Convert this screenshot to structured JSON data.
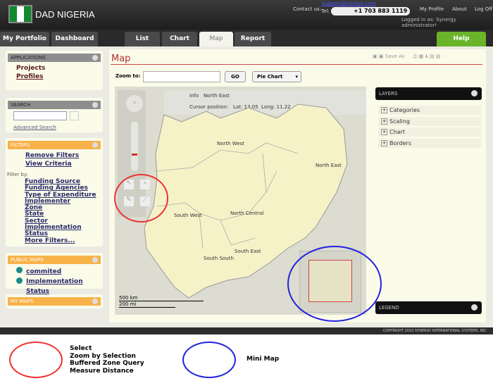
{
  "header": {
    "app_title": "DAD NIGERIA",
    "contact_label": "Contact us:",
    "email": "support@synisys.com",
    "tel_label": "Tel:",
    "phone": "+1 703 883 1119",
    "links": [
      "My Profile",
      "About",
      "Log Off"
    ],
    "logged_in": "Logged in as: Synergy administrator!"
  },
  "nav": {
    "portfolio": "My Portfolio",
    "dashboard": "Dashboard",
    "tabs": [
      "List",
      "Chart",
      "Map",
      "Report"
    ],
    "active_tab": "Map",
    "help": "Help"
  },
  "sidebar": {
    "applications": {
      "title": "APPLICATIONS",
      "items": [
        "Projects",
        "Profiles"
      ]
    },
    "search": {
      "title": "SEARCH",
      "value": "",
      "advanced": "Advanced Search"
    },
    "filters": {
      "title": "FILTERS",
      "actions": [
        "Remove Filters",
        "View Criteria"
      ],
      "filter_by": "Filter by:",
      "items": [
        "Funding Source",
        "Funding Agencies",
        "Type of Expenditure",
        "Implementer",
        "Zone",
        "State",
        "Sector",
        "Implementation Status",
        "More Filters..."
      ]
    },
    "public_maps": {
      "title": "PUBLIC MAPS",
      "items": [
        "commited",
        "Implementation Status"
      ]
    },
    "my_maps": {
      "title": "MY MAPS"
    }
  },
  "main": {
    "title": "Map",
    "save_as": "Save As",
    "zoom_label": "Zoom to:",
    "zoom_value": "",
    "go": "GO",
    "chart_type": "Pie Chart",
    "info_label": "Info",
    "info_value": "North East",
    "cursor_label": "Cursor position:",
    "lat_label": "Lat:",
    "lat": "13.05",
    "long_label": "Long:",
    "long": "11.22",
    "regions": [
      "North West",
      "North East",
      "North Central",
      "South West",
      "South East",
      "South South"
    ],
    "scale_km": "500 km",
    "scale_mi": "200 mi"
  },
  "layers": {
    "title": "LAYERS",
    "items": [
      "Categories",
      "Scaling",
      "Chart",
      "Borders"
    ],
    "legend": "LEGEND"
  },
  "footer": {
    "copyright": "COPYRIGHT 2010 SYNERGY INTERNATIONAL SYSTEMS, INC."
  },
  "annotations": {
    "red": [
      "Select",
      "Zoom by Selection",
      "Buffered Zone Query",
      "Measure Distance"
    ],
    "blue": "Mini Map"
  }
}
